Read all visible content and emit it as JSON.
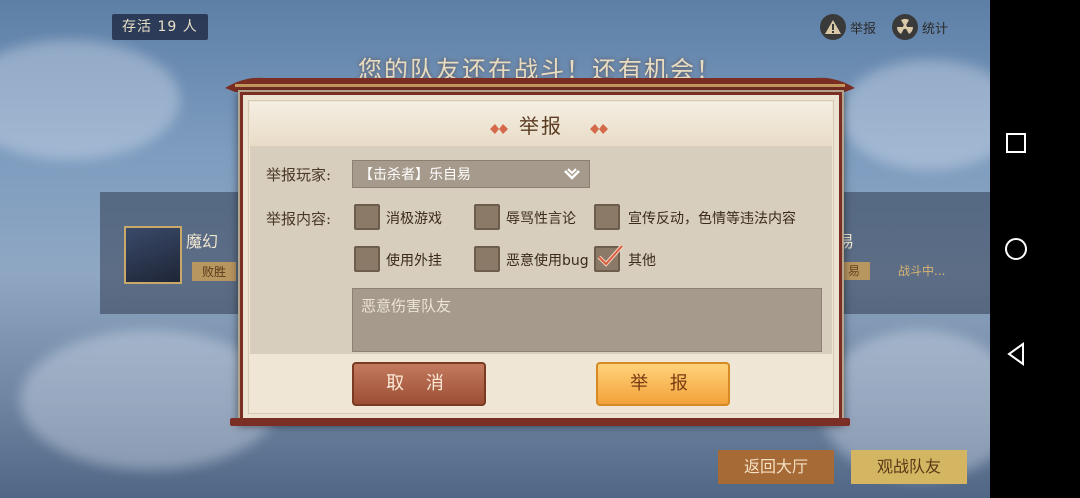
{
  "hud": {
    "survive_text": "存活 19   人",
    "report_label": "举报",
    "stats_label": "统计"
  },
  "banner": {
    "title": "您的队友还在战斗！还有机会！"
  },
  "background_players": {
    "left_name": "魔幻",
    "left_status": "败胜",
    "right_name": "易",
    "right_badge": "易",
    "right_status": "战斗中..."
  },
  "dialog": {
    "title": "举报",
    "player_label": "举报玩家:",
    "player_value": "【击杀者】乐自易",
    "content_label": "举报内容:",
    "options": [
      {
        "label": "消极游戏",
        "checked": false
      },
      {
        "label": "辱骂性言论",
        "checked": false
      },
      {
        "label": "宣传反动，色情等违法内容",
        "checked": false
      },
      {
        "label": "使用外挂",
        "checked": false
      },
      {
        "label": "恶意使用bug",
        "checked": false
      },
      {
        "label": "其他",
        "checked": true
      }
    ],
    "textarea_value": "恶意伤害队友",
    "cancel_label": "取 消",
    "report_label": "举 报"
  },
  "bottom": {
    "return_label": "返回大厅",
    "watch_label": "观战队友"
  },
  "colors": {
    "dialog_bg": "#efe6d6",
    "accent_orange": "#f3a23a",
    "cancel_red": "#9d4e35",
    "frame_red": "#7a2e24"
  }
}
